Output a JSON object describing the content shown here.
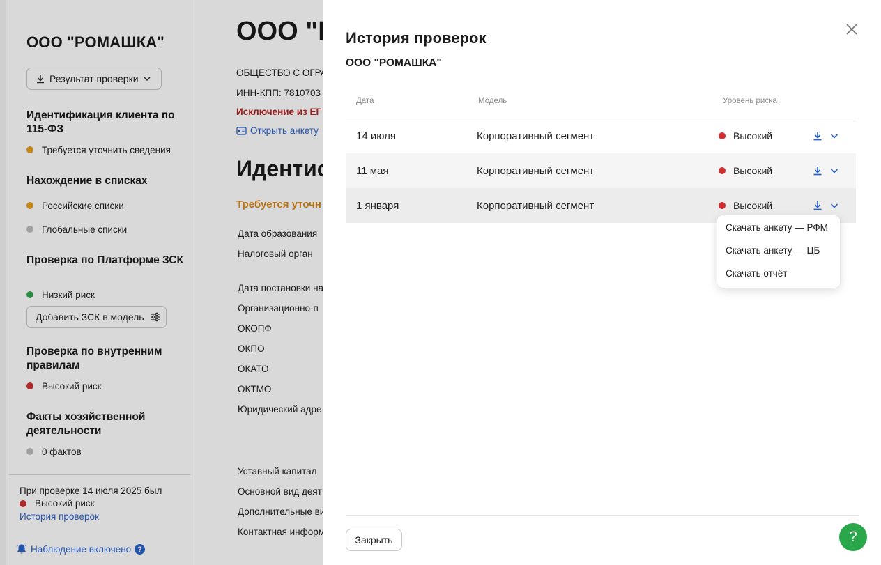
{
  "sidebar": {
    "company": "ООО \"РОМАШКА\"",
    "result_button": "Результат проверки",
    "sections": [
      {
        "title": "Идентификация клиента по 115-ФЗ",
        "items": [
          {
            "status": "orange",
            "label": "Требуется уточнить сведения"
          }
        ]
      },
      {
        "title": "Нахождение в списках",
        "items": [
          {
            "status": "orange",
            "label": "Российские списки"
          },
          {
            "status": "grey",
            "label": "Глобальные списки"
          }
        ]
      },
      {
        "title": "Проверка по Платформе ЗСК",
        "items": [
          {
            "status": "green",
            "label": "Низкий риск"
          }
        ],
        "button": "Добавить ЗСК в модель"
      },
      {
        "title": "Проверка по внутренним правилам",
        "items": [
          {
            "status": "red",
            "label": "Высокий риск"
          }
        ]
      },
      {
        "title": "Факты хозяйственной деятельности",
        "items": [
          {
            "status": "grey",
            "label": "0 фактов"
          }
        ]
      }
    ],
    "last_check_note": "При проверке 14 июля 2025 был",
    "last_check_risk": "Высокий риск",
    "history_link": "История проверок",
    "monitoring": "Наблюдение включено"
  },
  "main": {
    "title": "ООО \"Р",
    "full_name": "ОБЩЕСТВО С ОГРА",
    "inn": "ИНН-КПП: 7810703",
    "exclusion": "Исключение из ЕГ",
    "open_form": "Открыть анкету",
    "section_title": "Идентис",
    "section_status": "Требуется уточн",
    "fields": [
      "Дата образования",
      "Налоговый орган",
      "Дата постановки на",
      "Организационно-п",
      "ОКОПФ",
      "ОКПО",
      "ОКАТО",
      "ОКТМО",
      "Юридический адре",
      "Уставный капитал",
      "Основной вид деят",
      "Дополнительные ви",
      "Контактная информ"
    ]
  },
  "modal": {
    "title": "История проверок",
    "subtitle": "ООО \"РОМАШКА\"",
    "columns": {
      "date": "Дата",
      "model": "Модель",
      "risk": "Уровень риска"
    },
    "rows": [
      {
        "date": "14 июля",
        "model": "Корпоративный сегмент",
        "risk": "Высокий"
      },
      {
        "date": "11 мая",
        "model": "Корпоративный сегмент",
        "risk": "Высокий"
      },
      {
        "date": "1 января",
        "model": "Корпоративный сегмент",
        "risk": "Высокий"
      }
    ],
    "dropdown": [
      "Скачать анкету — РФМ",
      "Скачать анкету — ЦБ",
      "Скачать отчёт"
    ],
    "close_button": "Закрыть",
    "help": "?"
  },
  "colors": {
    "accent": "#2a62c9",
    "risk_high": "#cf2f2f",
    "risk_low": "#34a853",
    "warning": "#e5a022",
    "help": "#2aa74a"
  }
}
